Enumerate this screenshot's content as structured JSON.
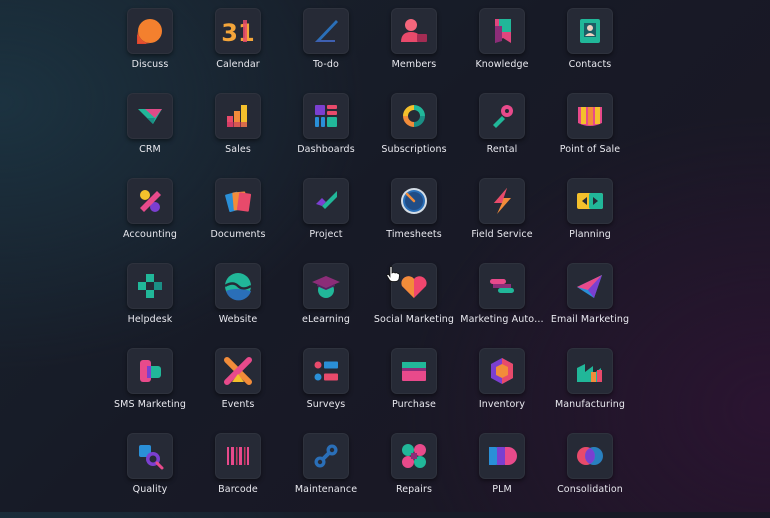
{
  "apps": [
    {
      "label": "Discuss",
      "icon": "discuss-icon"
    },
    {
      "label": "Calendar",
      "icon": "calendar-icon",
      "icon_text": "31"
    },
    {
      "label": "To-do",
      "icon": "todo-icon"
    },
    {
      "label": "Members",
      "icon": "members-icon"
    },
    {
      "label": "Knowledge",
      "icon": "knowledge-icon"
    },
    {
      "label": "Contacts",
      "icon": "contacts-icon"
    },
    {
      "label": "CRM",
      "icon": "crm-icon"
    },
    {
      "label": "Sales",
      "icon": "sales-icon"
    },
    {
      "label": "Dashboards",
      "icon": "dashboards-icon"
    },
    {
      "label": "Subscriptions",
      "icon": "subscriptions-icon"
    },
    {
      "label": "Rental",
      "icon": "rental-icon"
    },
    {
      "label": "Point of Sale",
      "icon": "point-of-sale-icon"
    },
    {
      "label": "Accounting",
      "icon": "accounting-icon"
    },
    {
      "label": "Documents",
      "icon": "documents-icon"
    },
    {
      "label": "Project",
      "icon": "project-icon"
    },
    {
      "label": "Timesheets",
      "icon": "timesheets-icon"
    },
    {
      "label": "Field Service",
      "icon": "field-service-icon"
    },
    {
      "label": "Planning",
      "icon": "planning-icon"
    },
    {
      "label": "Helpdesk",
      "icon": "helpdesk-icon"
    },
    {
      "label": "Website",
      "icon": "website-icon"
    },
    {
      "label": "eLearning",
      "icon": "elearning-icon"
    },
    {
      "label": "Social Marketing",
      "icon": "social-marketing-icon"
    },
    {
      "label": "Marketing Auto…",
      "icon": "marketing-automation-icon"
    },
    {
      "label": "Email Marketing",
      "icon": "email-marketing-icon"
    },
    {
      "label": "SMS Marketing",
      "icon": "sms-marketing-icon"
    },
    {
      "label": "Events",
      "icon": "events-icon"
    },
    {
      "label": "Surveys",
      "icon": "surveys-icon"
    },
    {
      "label": "Purchase",
      "icon": "purchase-icon"
    },
    {
      "label": "Inventory",
      "icon": "inventory-icon"
    },
    {
      "label": "Manufacturing",
      "icon": "manufacturing-icon"
    },
    {
      "label": "Quality",
      "icon": "quality-icon"
    },
    {
      "label": "Barcode",
      "icon": "barcode-icon"
    },
    {
      "label": "Maintenance",
      "icon": "maintenance-icon"
    },
    {
      "label": "Repairs",
      "icon": "repairs-icon"
    },
    {
      "label": "PLM",
      "icon": "plm-icon"
    },
    {
      "label": "Consolidation",
      "icon": "consolidation-icon"
    }
  ],
  "colors": {
    "orange": "#f28c3a",
    "pink": "#f0466e",
    "teal": "#21b799",
    "blue": "#2a8fd7",
    "purple": "#7b3fd0",
    "yellow": "#f4c02c",
    "label": "#e9e9ef"
  }
}
